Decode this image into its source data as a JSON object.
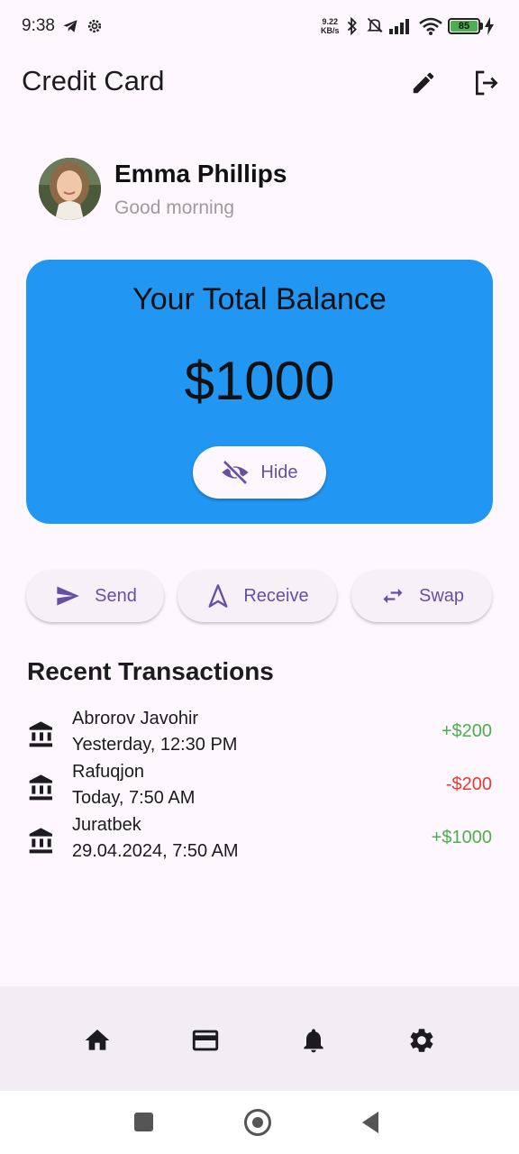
{
  "status_bar": {
    "time": "9:38",
    "net_speed_value": "9.22",
    "net_speed_unit": "KB/s",
    "battery_level": "85",
    "icons": [
      "telegram-icon",
      "gear-icon",
      "bluetooth-icon",
      "mute-icon",
      "signal-icon",
      "wifi-icon",
      "battery-icon",
      "charging-icon"
    ]
  },
  "app_bar": {
    "title": "Credit Card",
    "actions": [
      "edit-icon",
      "logout-icon"
    ]
  },
  "profile": {
    "name": "Emma Phillips",
    "greeting": "Good morning"
  },
  "balance": {
    "title": "Your Total Balance",
    "amount": "$1000",
    "hide_label": "Hide",
    "card_color": "#2196f3"
  },
  "actions": {
    "send_label": "Send",
    "receive_label": "Receive",
    "swap_label": "Swap"
  },
  "transactions": {
    "title": "Recent Transactions",
    "items": [
      {
        "name": "Abrorov Javohir",
        "date": "Yesterday, 12:30 PM",
        "amount": "+$200",
        "type": "credit"
      },
      {
        "name": "Rafuqjon",
        "date": "Today, 7:50 AM",
        "amount": "-$200",
        "type": "debit"
      },
      {
        "name": "Juratbek",
        "date": "29.04.2024, 7:50 AM",
        "amount": "+$1000",
        "type": "credit"
      }
    ]
  },
  "bottom_nav": {
    "items": [
      "home-icon",
      "credit-card-icon",
      "bell-icon",
      "settings-icon"
    ]
  },
  "colors": {
    "accent": "#6750a4",
    "positive": "#4caf50",
    "negative": "#e53935",
    "background": "#fef7fd"
  }
}
